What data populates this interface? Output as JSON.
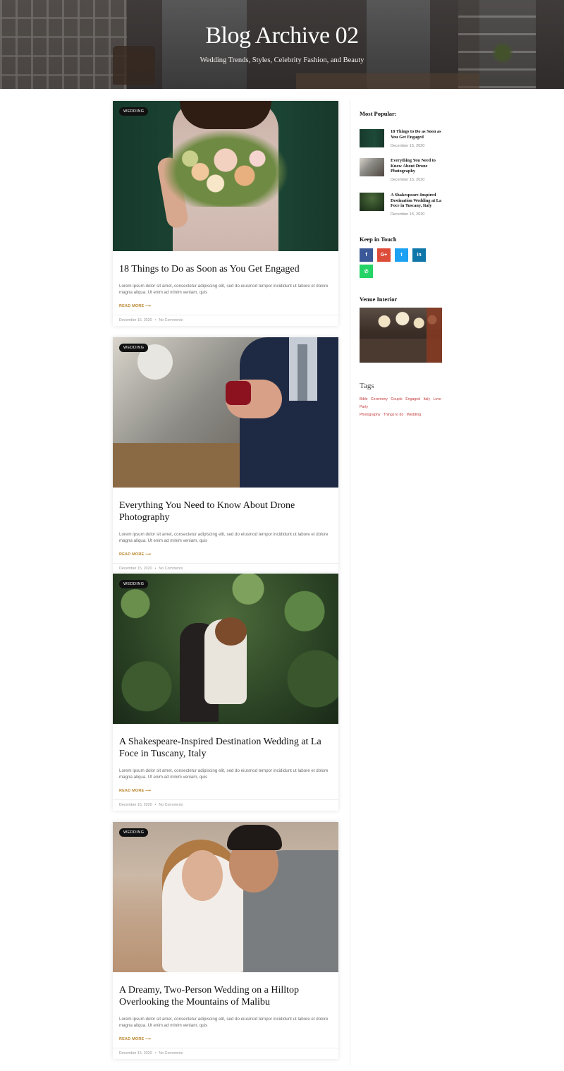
{
  "hero": {
    "title": "Blog Archive 02",
    "subtitle": "Wedding Trends, Styles, Celebrity Fashion, and Beauty"
  },
  "posts": [
    {
      "category": "WEDDING",
      "title": "18 Things to Do as Soon as You Get Engaged",
      "excerpt": "Lorem ipsum dolor sit amet, consectetur adipiscing elit, sed do eiusmod tempor incididunt ut labore et dolore magna aliqua. Ut enim ad minim veniam, quis",
      "read_more": "READ MORE ⟶",
      "date": "December 15, 2020",
      "comments": "No Comments"
    },
    {
      "category": "WEDDING",
      "title": "Everything You Need to Know About Drone Photography",
      "excerpt": "Lorem ipsum dolor sit amet, consectetur adipiscing elit, sed do eiusmod tempor incididunt ut labore et dolore magna aliqua. Ut enim ad minim veniam, quis",
      "read_more": "READ MORE ⟶",
      "date": "December 15, 2020",
      "comments": "No Comments"
    },
    {
      "category": "WEDDING",
      "title": "A Shakespeare-Inspired Destination Wedding at La Foce in Tuscany, Italy",
      "excerpt": "Lorem ipsum dolor sit amet, consectetur adipiscing elit, sed do eiusmod tempor incididunt ut labore et dolore magna aliqua. Ut enim ad minim veniam, quis",
      "read_more": "READ MORE ⟶",
      "date": "December 15, 2020",
      "comments": "No Comments"
    },
    {
      "category": "WEDDING",
      "title": "A Dreamy, Two-Person Wedding on a Hilltop Overlooking the Mountains of Malibu",
      "excerpt": "Lorem ipsum dolor sit amet, consectetur adipiscing elit, sed do eiusmod tempor incididunt ut labore et dolore magna aliqua. Ut enim ad minim veniam, quis",
      "read_more": "READ MORE ⟶",
      "date": "December 15, 2020",
      "comments": "No Comments"
    }
  ],
  "sidebar": {
    "popular_heading": "Most Popular:",
    "popular": [
      {
        "title": "18 Things to Do as Soon as You Get Engaged",
        "date": "December 15, 2020"
      },
      {
        "title": "Everything You Need to Know About Drone Photography",
        "date": "December 15, 2020"
      },
      {
        "title": "A Shakespeare-Inspired Destination Wedding at La Foce in Tuscany, Italy",
        "date": "December 15, 2020"
      }
    ],
    "social_heading": "Keep in Touch",
    "social": [
      {
        "icon": "facebook-icon",
        "glyph": "f",
        "color": "#3b5998"
      },
      {
        "icon": "google-plus-icon",
        "glyph": "G+",
        "color": "#dd4b39"
      },
      {
        "icon": "twitter-icon",
        "glyph": "t",
        "color": "#1da1f2"
      },
      {
        "icon": "linkedin-icon",
        "glyph": "in",
        "color": "#0e76a8"
      },
      {
        "icon": "whatsapp-icon",
        "glyph": "✆",
        "color": "#25d366"
      }
    ],
    "venue_heading": "Venue Interior",
    "tags_heading": "Tags",
    "tags": [
      "Bible",
      "Ceremony",
      "Couple",
      "Engaged",
      "Italy",
      "Love",
      "Party",
      "Photography",
      "Things to do",
      "Wedding"
    ]
  }
}
